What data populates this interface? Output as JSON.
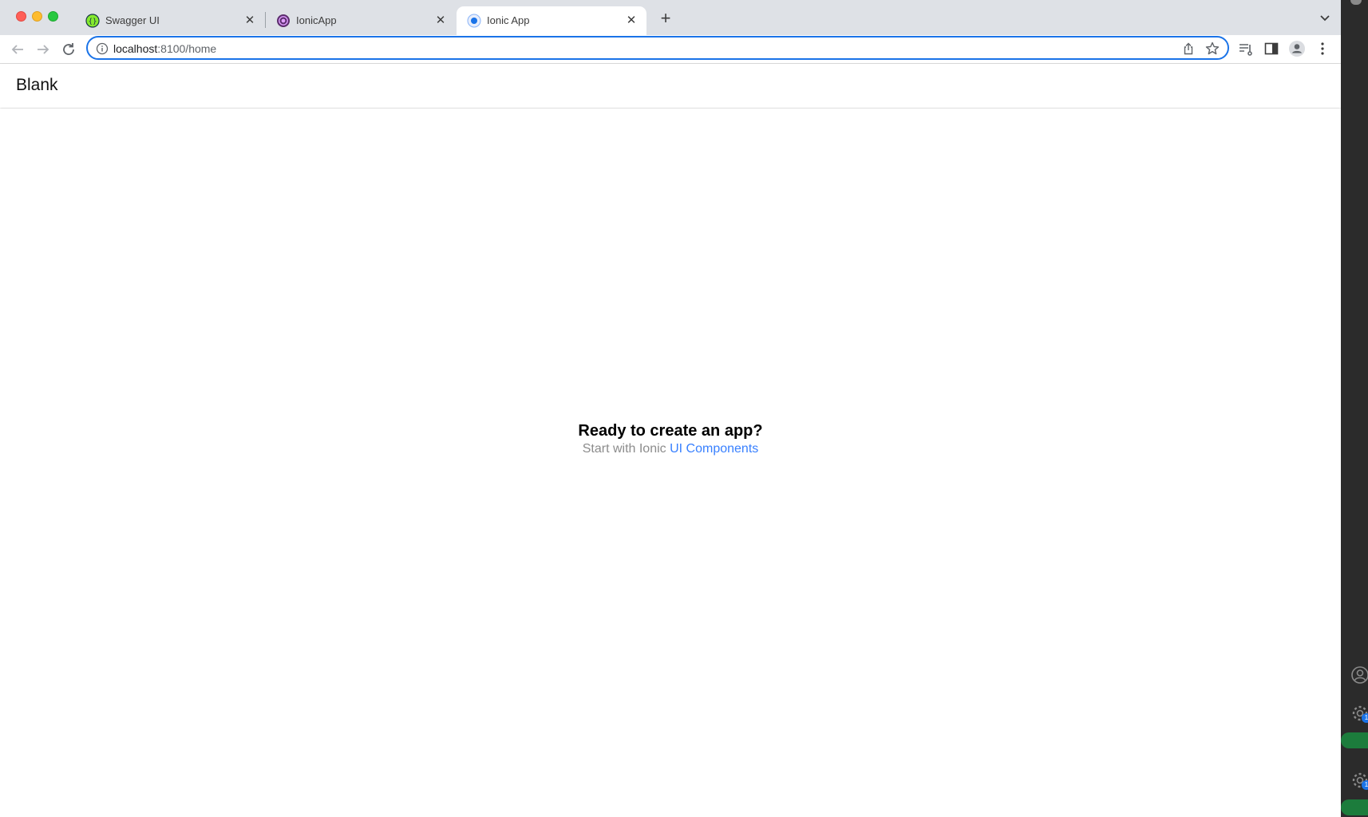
{
  "browser": {
    "tabs": [
      {
        "title": "Swagger UI",
        "icon": "swagger-icon",
        "active": false
      },
      {
        "title": "IonicApp",
        "icon": "ionic-icon",
        "active": false
      },
      {
        "title": "Ionic App",
        "icon": "chrome-icon",
        "active": true
      }
    ],
    "address": {
      "host": "localhost",
      "path": ":8100/home"
    }
  },
  "app": {
    "header_title": "Blank",
    "heading": "Ready to create an app?",
    "sub_prefix": "Start with Ionic ",
    "sub_link": "UI Components"
  },
  "side": {
    "badge_1": "1",
    "badge_2": "1"
  },
  "colors": {
    "accent": "#1a73e8",
    "ionic_link": "#3880ff"
  }
}
